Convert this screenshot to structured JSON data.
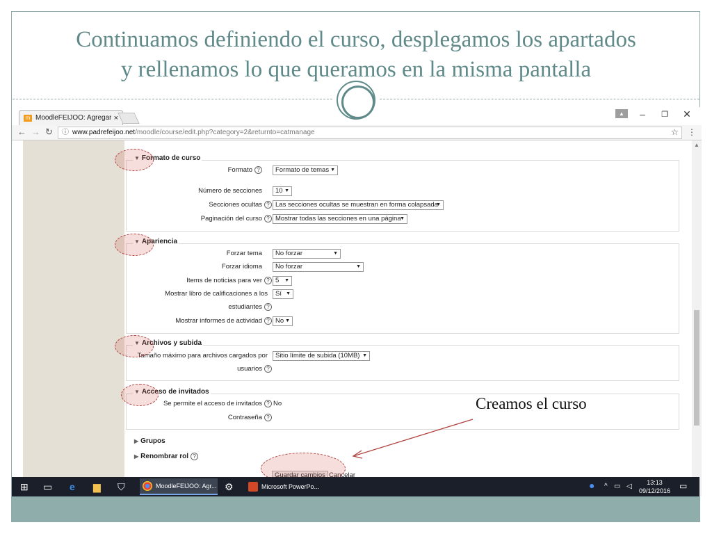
{
  "slide": {
    "title_line1": "Continuamos definiendo el curso, desplegamos los apartados",
    "title_line2": "y rellenamos lo que queramos en la misma pantalla",
    "annotation": "Creamos el curso"
  },
  "browser": {
    "tab_title": "MoodleFEIJOO: Agregar",
    "tab_close": "×",
    "url_host": "www.padrefeijoo.net",
    "url_path": "/moodle/course/edit.php?category=2&returnto=catmanage"
  },
  "form": {
    "formato_curso": {
      "legend": "Formato de curso",
      "formato_label": "Formato",
      "formato_value": "Formato de temas",
      "num_secciones_label": "Número de secciones",
      "num_secciones_value": "10",
      "secciones_ocultas_label": "Secciones ocultas",
      "secciones_ocultas_value": "Las secciones ocultas se muestran en forma colapsada",
      "paginacion_label": "Paginación del curso",
      "paginacion_value": "Mostrar todas las secciones en una página"
    },
    "apariencia": {
      "legend": "Apariencia",
      "forzar_tema_label": "Forzar tema",
      "forzar_tema_value": "No forzar",
      "forzar_idioma_label": "Forzar idioma",
      "forzar_idioma_value": "No forzar",
      "items_noticias_label": "Items de noticias para ver",
      "items_noticias_value": "5",
      "libro_calif_label_1": "Mostrar libro de calificaciones a los",
      "libro_calif_label_2": "estudiantes",
      "libro_calif_value": "Sí",
      "informes_label": "Mostrar informes de actividad",
      "informes_value": "No"
    },
    "archivos": {
      "legend": "Archivos y subida",
      "tamano_label_1": "Tamaño máximo para archivos cargados por",
      "tamano_label_2": "usuarios",
      "tamano_value": "Sitio límite de subida (10MB)"
    },
    "invitados": {
      "legend": "Acceso de invitados",
      "permite_label": "Se permite el acceso de invitados",
      "permite_value": "No",
      "contrasena_label": "Contraseña"
    },
    "grupos": "Grupos",
    "renombrar_rol": "Renombrar rol",
    "save_label": "Guardar cambios",
    "cancel_label": "Cancelar"
  },
  "taskbar": {
    "chrome_task": "MoodleFEIJOO: Agr...",
    "ppt_task": "Microsoft PowerPo...",
    "time": "13:13",
    "date": "09/12/2016"
  },
  "colors": {
    "title": "#5f8a89",
    "footer": "#8fadab",
    "annotation": "#b0413e",
    "moodle_left": "#e5e0d6"
  }
}
